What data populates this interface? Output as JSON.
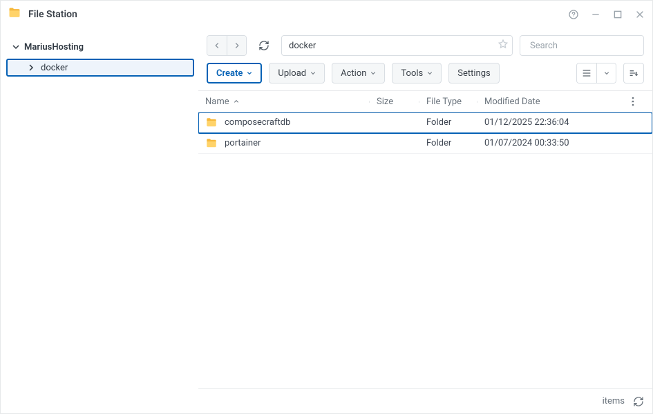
{
  "title": "File Station",
  "sidebar": {
    "root": "MariusHosting",
    "child": "docker"
  },
  "path_value": "docker",
  "search_placeholder": "Search",
  "toolbar": {
    "create": "Create",
    "upload": "Upload",
    "action": "Action",
    "tools": "Tools",
    "settings": "Settings"
  },
  "columns": {
    "name": "Name",
    "size": "Size",
    "type": "File Type",
    "modified": "Modified Date"
  },
  "rows": [
    {
      "name": "composecraftdb",
      "size": "",
      "type": "Folder",
      "modified": "01/12/2025 22:36:04",
      "highlight": true
    },
    {
      "name": "portainer",
      "size": "",
      "type": "Folder",
      "modified": "01/07/2024 00:33:50",
      "highlight": false
    }
  ],
  "footer": {
    "items_label": "items"
  }
}
